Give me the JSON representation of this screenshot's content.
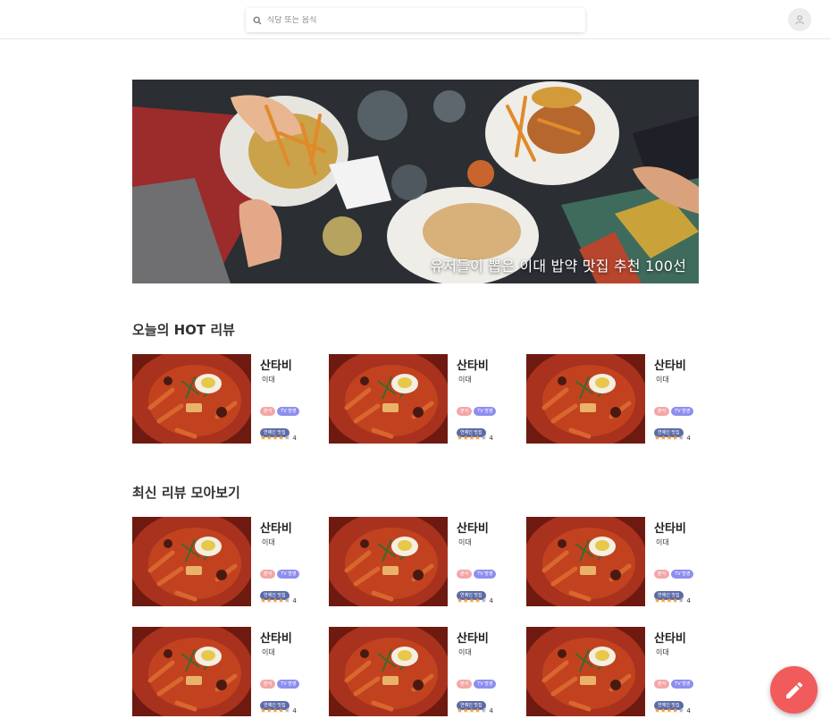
{
  "header": {
    "search_placeholder": "식당 또는 음식",
    "search_icon": "search-icon",
    "profile_icon": "user-icon"
  },
  "hero": {
    "caption": "유저들이 뽑은 이대 밥약 맛집 추천 100선"
  },
  "hot_reviews": {
    "title": "오늘의 HOT 리뷰",
    "cards": [
      {
        "name": "산타비",
        "location": "이대",
        "tags": [
          "분식",
          "TV 방영",
          "연예인 맛집"
        ],
        "rating": 4
      },
      {
        "name": "산타비",
        "location": "이대",
        "tags": [
          "분식",
          "TV 방영",
          "연예인 맛집"
        ],
        "rating": 4
      },
      {
        "name": "산타비",
        "location": "이대",
        "tags": [
          "분식",
          "TV 방영",
          "연예인 맛집"
        ],
        "rating": 4
      }
    ]
  },
  "recent_reviews": {
    "title": "최신 리뷰 모아보기",
    "cards": [
      {
        "name": "산타비",
        "location": "이대",
        "tags": [
          "분식",
          "TV 방영",
          "연예인 맛집"
        ],
        "rating": 4
      },
      {
        "name": "산타비",
        "location": "이대",
        "tags": [
          "분식",
          "TV 방영",
          "연예인 맛집"
        ],
        "rating": 4
      },
      {
        "name": "산타비",
        "location": "이대",
        "tags": [
          "분식",
          "TV 방영",
          "연예인 맛집"
        ],
        "rating": 4
      },
      {
        "name": "산타비",
        "location": "이대",
        "tags": [
          "분식",
          "TV 방영",
          "연예인 맛집"
        ],
        "rating": 4
      },
      {
        "name": "산타비",
        "location": "이대",
        "tags": [
          "분식",
          "TV 방영",
          "연예인 맛집"
        ],
        "rating": 4
      },
      {
        "name": "산타비",
        "location": "이대",
        "tags": [
          "분식",
          "TV 방영",
          "연예인 맛집"
        ],
        "rating": 4
      }
    ]
  },
  "fab": {
    "icon": "pencil-icon"
  },
  "colors": {
    "star": "#f2a03d",
    "tag_food": "#f4a6a6",
    "tag_tv": "#8e8ef0",
    "tag_celeb": "#5b6aa8",
    "fab": "#f15b5b"
  }
}
